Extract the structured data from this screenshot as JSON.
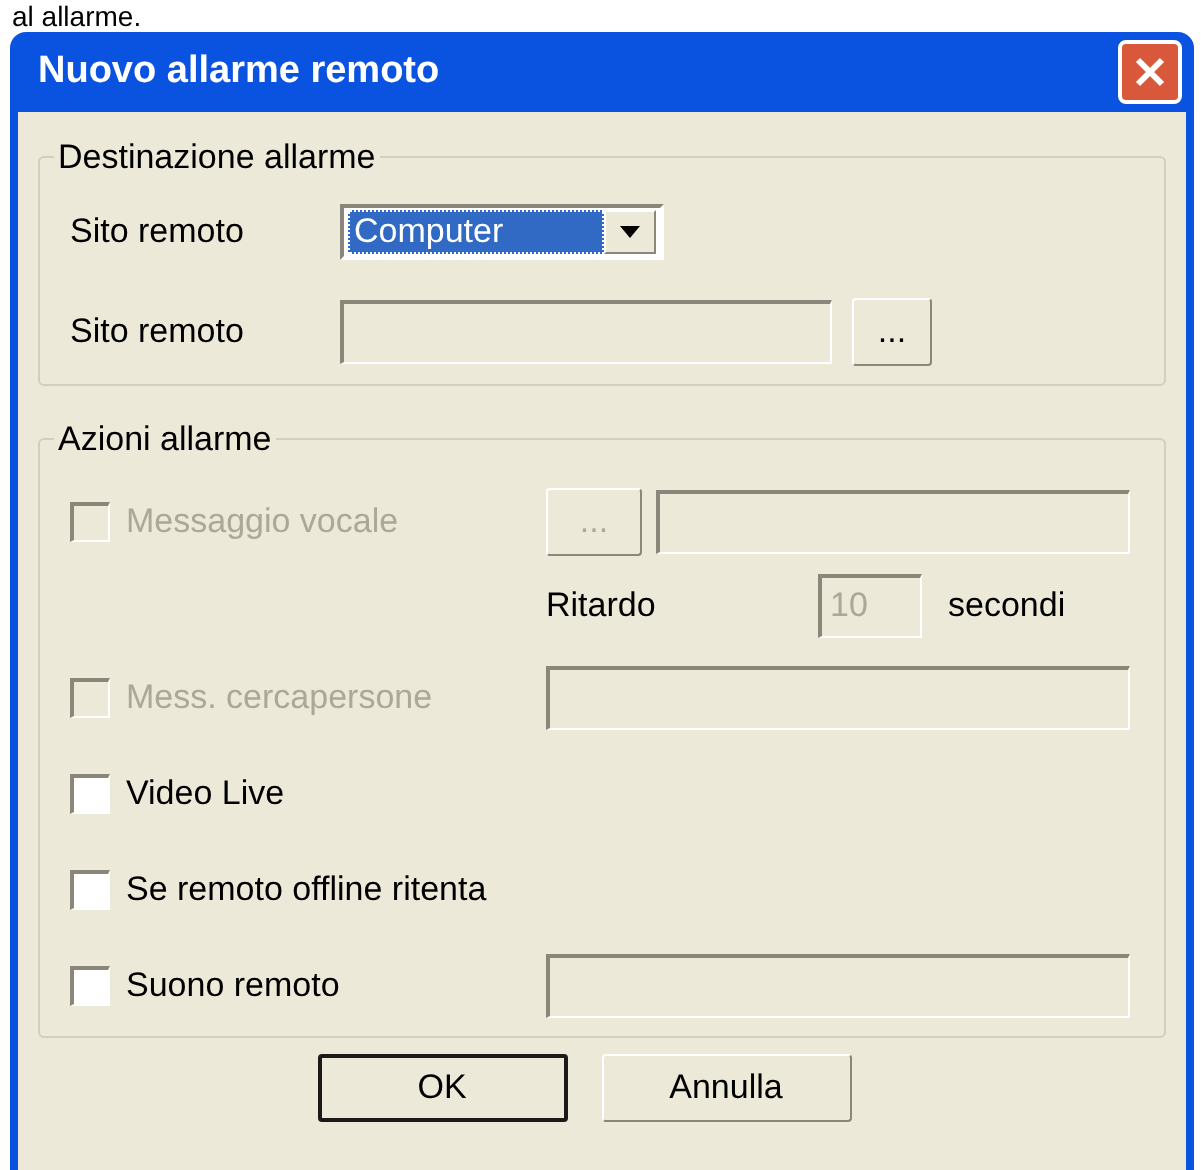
{
  "background_text": "al allarme.",
  "window": {
    "title": "Nuovo allarme remoto"
  },
  "destination": {
    "title": "Destinazione allarme",
    "site_type": {
      "label": "Sito remoto",
      "value": "Computer"
    },
    "site": {
      "label": "Sito remoto",
      "browse": "..."
    }
  },
  "actions": {
    "title": "Azioni allarme",
    "voice_message": {
      "label": "Messaggio vocale",
      "checked": false,
      "disabled": true,
      "browse": "...",
      "browse_disabled": true
    },
    "delay": {
      "label": "Ritardo",
      "value": "10",
      "unit": "secondi",
      "disabled": true
    },
    "pager_message": {
      "label": "Mess. cercapersone",
      "checked": false,
      "disabled": true
    },
    "video_live": {
      "label": "Video Live",
      "checked": false,
      "disabled": false
    },
    "retry_offline": {
      "label": "Se remoto offline ritenta",
      "checked": false,
      "disabled": false
    },
    "remote_sound": {
      "label": "Suono remoto",
      "checked": false,
      "disabled": false
    }
  },
  "buttons": [
    {
      "label": "OK",
      "default": true
    },
    {
      "label": "Annulla",
      "default": false
    }
  ]
}
